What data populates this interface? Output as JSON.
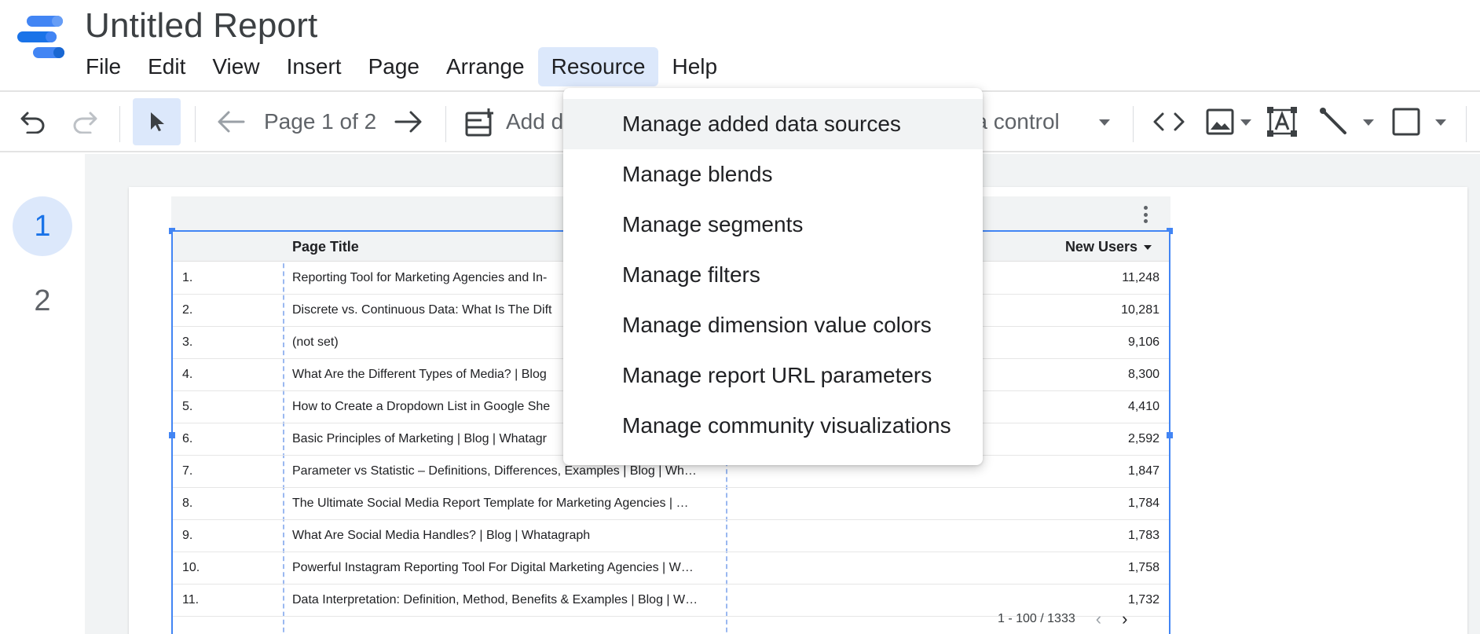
{
  "app": {
    "title": "Untitled Report"
  },
  "menu": {
    "items": [
      "File",
      "Edit",
      "View",
      "Insert",
      "Page",
      "Arrange",
      "Resource",
      "Help"
    ],
    "active": "Resource"
  },
  "toolbar": {
    "page_label": "Page 1 of 2",
    "add_data_label": "Add d",
    "add_control_label": "d a control",
    "icons": [
      "undo-icon",
      "redo-icon",
      "select-cursor-icon",
      "prev-page-icon",
      "next-page-icon",
      "add-data-icon",
      "embed-code-icon",
      "image-icon",
      "text-box-icon",
      "line-icon",
      "shape-rectangle-icon"
    ]
  },
  "pages": {
    "items": [
      "1",
      "2"
    ],
    "current": "1"
  },
  "table": {
    "columns": {
      "title": "Page Title",
      "metric": "New Users"
    },
    "rows": [
      {
        "num": "1.",
        "title": "Reporting Tool for Marketing Agencies and In-",
        "value": "11,248"
      },
      {
        "num": "2.",
        "title": "Discrete vs. Continuous Data: What Is The Dift",
        "value": "10,281"
      },
      {
        "num": "3.",
        "title": "(not set)",
        "value": "9,106"
      },
      {
        "num": "4.",
        "title": "What Are the Different Types of Media? | Blog",
        "value": "8,300"
      },
      {
        "num": "5.",
        "title": "How to Create a Dropdown List in Google She",
        "value": "4,410"
      },
      {
        "num": "6.",
        "title": "Basic Principles of Marketing | Blog | Whatagr",
        "value": "2,592"
      },
      {
        "num": "7.",
        "title": "Parameter vs Statistic – Definitions, Differences, Examples | Blog | Wh…",
        "value": "1,847"
      },
      {
        "num": "8.",
        "title": "The Ultimate Social Media Report Template for Marketing Agencies | …",
        "value": "1,784"
      },
      {
        "num": "9.",
        "title": "What Are Social Media Handles? | Blog | Whatagraph",
        "value": "1,783"
      },
      {
        "num": "10.",
        "title": "Powerful Instagram Reporting Tool For Digital Marketing Agencies | W…",
        "value": "1,758"
      },
      {
        "num": "11.",
        "title": "Data Interpretation: Definition, Method, Benefits & Examples | Blog | W…",
        "value": "1,732"
      }
    ],
    "pagination": "1 - 100 / 1333",
    "prev": "‹",
    "next": "›"
  },
  "dropdown": {
    "items": [
      "Manage added data sources",
      "Manage blends",
      "Manage segments",
      "Manage filters",
      "Manage dimension value colors",
      "Manage report URL parameters",
      "Manage community visualizations"
    ],
    "hovered_index": 0
  },
  "colors": {
    "accent": "#1a73e8",
    "selection_blue": "#4285f4",
    "active_bg": "#dce8fb"
  }
}
